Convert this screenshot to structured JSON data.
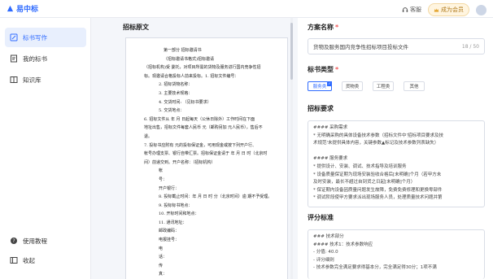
{
  "app": {
    "name": "易中标"
  },
  "topbar": {
    "service_label": "客服",
    "vip_label": "成为会员"
  },
  "sidebar": {
    "items": [
      {
        "label": "标书写作",
        "icon": "pen-icon"
      },
      {
        "label": "我的标书",
        "icon": "file-icon"
      },
      {
        "label": "知识库",
        "icon": "book-icon"
      }
    ],
    "bottom": [
      {
        "label": "使用教程",
        "icon": "help-icon"
      },
      {
        "label": "收起",
        "icon": "collapse-icon"
      }
    ]
  },
  "doc": {
    "title": "招标原文",
    "lines": [
      "第一部分 招标邀请书",
      "（招标邀请书格式)招标邀请",
      "（招标机构)受 委托，对项目所需的货物及服务进行国内竞争性招",
      "标。现邀请合格投标人前来投标。1. 招标文件编号：",
      "2. 招标货物名称：",
      "3. 主要技术规格：",
      "4. 交货时间: （见标书要求）",
      "5. 交货地点：",
      "6. 招标文件从 年 月 日起每天（公休日除外）工作时间在下面",
      "地址出售，招标文件每套人民币 元（邮购另加 元人民币），售后不",
      "退。",
      "7. 投标书应附有 元的投标保证金，可用现金或按下列开户行、",
      "帐号办理支票、银行自带汇票。招标保证金请于 年 月 日 时（北京时",
      "间）前递交到。开户名称：（招标机构）",
      "帐",
      "号：",
      "开户银行：",
      "8. 投标截止时间：年 月 日 时 分（北京时间）逾 期不予受理。",
      "9. 投标标书地点：",
      "10. 开标时间和地点：",
      "11. 通讯地址：",
      "邮政编码：",
      "电报挂号：",
      "电",
      "话：",
      "传",
      "真："
    ]
  },
  "form": {
    "name_label": "方案名称",
    "name_value": "货物及服务国内竞争性招标项目投标文件",
    "name_count": "18 / 50",
    "type_label": "标书类型",
    "types": [
      "服务类",
      "货物类",
      "工程类",
      "其他"
    ],
    "selected_type": "服务类",
    "req_label": "招标要求",
    "req_lines": [
      "#### 采购需求",
      "* 无明确采购的具体设备技术参数（招标文件中'招标项目要求及技",
      "术规范'未提供具体内容，关键参数▲标记及技术参数列表缺失）",
      "",
      "#### 服务要求",
      "* 提供设计、安装、调试、技术指导及培训服务",
      "* 设备质量保证期为现场安装验收合格后[未明确]个月（若甲方未",
      "及时安装，最长不超过自到货之日起[未明确]个月）",
      "* 保证期内设备因质量问题发生故障，免费免费修理和更换零部件",
      "* 调试阶段使甲方要求派出现场服务人员，处理质量技术问题并第"
    ],
    "eval_label": "评分标准",
    "eval_lines": [
      "### 技术部分",
      "#### 技术1：技术参数响应",
      "- 分值: 40.0",
      "- 评分细则",
      "- 技术参数完全满足要求得基本分，完全满足得30分；1项不满"
    ]
  },
  "colors": {
    "accent": "#2f6bff",
    "required": "#f25858"
  }
}
